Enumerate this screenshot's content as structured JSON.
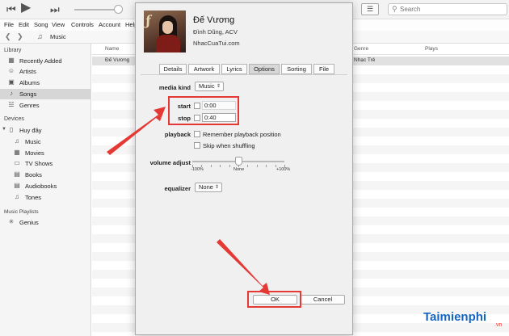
{
  "search": {
    "placeholder": "Search"
  },
  "menu": [
    "File",
    "Edit",
    "Song",
    "View",
    "Controls",
    "Account",
    "Help"
  ],
  "nav": {
    "section": "Music"
  },
  "sidebar": {
    "library_header": "Library",
    "library": [
      "Recently Added",
      "Artists",
      "Albums",
      "Songs",
      "Genres"
    ],
    "devices_header": "Devices",
    "device_name": "Huy đây",
    "device_items": [
      "Music",
      "Movies",
      "TV Shows",
      "Books",
      "Audiobooks",
      "Tones"
    ],
    "playlists_header": "Music Playlists",
    "playlists": [
      "Genius"
    ]
  },
  "song_list": {
    "columns": {
      "name": "Name",
      "genre": "Genre",
      "plays": "Plays"
    },
    "selected_row": {
      "name": "Đế Vương",
      "genre": "Nhạc Trẻ"
    }
  },
  "dialog": {
    "title": "Đế Vương",
    "artist": "Đình Dũng, ACV",
    "album": "NhacCuaTui.com",
    "tabs": [
      "Details",
      "Artwork",
      "Lyrics",
      "Options",
      "Sorting",
      "File"
    ],
    "active_tab": "Options",
    "media_kind_label": "media kind",
    "media_kind_value": "Music",
    "start_label": "start",
    "start_value": "0:00",
    "stop_label": "stop",
    "stop_value": "0:40",
    "playback_label": "playback",
    "remember_position": "Remember playback position",
    "skip_shuffling": "Skip when shuffling",
    "volume_label": "volume adjust",
    "volume_ticks": [
      "-100%",
      "None",
      "+100%"
    ],
    "volume_level_percent": 0,
    "equalizer_label": "equalizer",
    "equalizer_value": "None",
    "ok_label": "OK",
    "cancel_label": "Cancel"
  },
  "watermark": {
    "brand": "Taimienphi",
    "suffix": ".vn"
  },
  "colors": {
    "highlight": "#e53935",
    "brand": "#1565c0"
  }
}
